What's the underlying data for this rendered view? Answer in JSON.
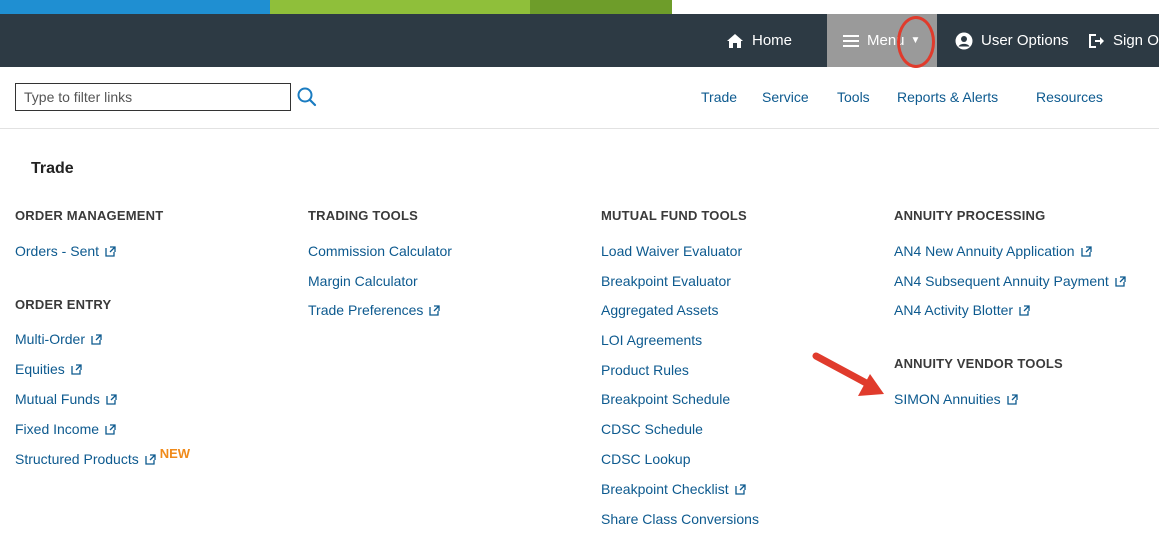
{
  "header": {
    "home_label": "Home",
    "menu_label": "Menu",
    "user_options_label": "User Options",
    "sign_out_label": "Sign O"
  },
  "filter": {
    "placeholder": "Type to filter links"
  },
  "tabs": [
    "Trade",
    "Service",
    "Tools",
    "Reports & Alerts",
    "Resources"
  ],
  "section": {
    "title": "Trade"
  },
  "columns": [
    {
      "groups": [
        {
          "heading": "ORDER MANAGEMENT",
          "links": [
            {
              "label": "Orders - Sent",
              "external": true
            }
          ]
        },
        {
          "heading": "ORDER ENTRY",
          "links": [
            {
              "label": "Multi-Order",
              "external": true
            },
            {
              "label": "Equities",
              "external": true
            },
            {
              "label": "Mutual Funds",
              "external": true
            },
            {
              "label": "Fixed Income",
              "external": true
            },
            {
              "label": "Structured Products",
              "external": true,
              "badge": "NEW"
            }
          ]
        }
      ]
    },
    {
      "groups": [
        {
          "heading": "TRADING TOOLS",
          "links": [
            {
              "label": "Commission Calculator",
              "external": false
            },
            {
              "label": "Margin Calculator",
              "external": false
            },
            {
              "label": "Trade Preferences",
              "external": true
            }
          ]
        }
      ]
    },
    {
      "groups": [
        {
          "heading": "MUTUAL FUND TOOLS",
          "links": [
            {
              "label": "Load Waiver Evaluator",
              "external": false
            },
            {
              "label": "Breakpoint Evaluator",
              "external": false
            },
            {
              "label": "Aggregated Assets",
              "external": false
            },
            {
              "label": "LOI Agreements",
              "external": false
            },
            {
              "label": "Product Rules",
              "external": false
            },
            {
              "label": "Breakpoint Schedule",
              "external": false
            },
            {
              "label": "CDSC Schedule",
              "external": false
            },
            {
              "label": "CDSC Lookup",
              "external": false
            },
            {
              "label": "Breakpoint Checklist",
              "external": true
            },
            {
              "label": "Share Class Conversions",
              "external": false
            }
          ]
        }
      ]
    },
    {
      "groups": [
        {
          "heading": "ANNUITY PROCESSING",
          "links": [
            {
              "label": "AN4 New Annuity Application",
              "external": true
            },
            {
              "label": "AN4 Subsequent Annuity Payment",
              "external": true
            },
            {
              "label": "AN4 Activity Blotter",
              "external": true
            }
          ]
        },
        {
          "heading": "ANNUITY VENDOR TOOLS",
          "links": [
            {
              "label": "SIMON Annuities",
              "external": true
            }
          ]
        }
      ]
    }
  ],
  "colors": {
    "link": "#0d5a8f",
    "topbar": "#2d3a44",
    "menu_active": "#9a9a9a",
    "badge": "#f08a1a",
    "annotation": "#e03b2c"
  }
}
